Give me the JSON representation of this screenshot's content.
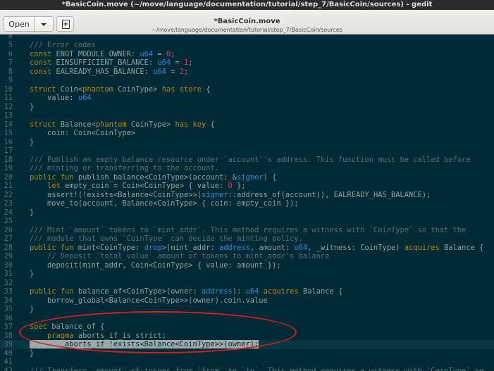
{
  "window": {
    "title": "*BasicCoin.move (~/move/language/documentation/tutorial/step_7/BasicCoin/sources) - gedit"
  },
  "header": {
    "open_label": "Open",
    "doc_title": "*BasicCoin.move",
    "doc_path": "~/move/language/documentation/tutorial/step_7/BasicCoin/sources"
  },
  "icons": {
    "menu": "chevron-down-icon",
    "new_document": "new-document-icon"
  },
  "colors": {
    "editor_bg": "#002b36",
    "annotation": "#d42020",
    "current_line": "#073642"
  },
  "editor": {
    "lines": [
      {
        "n": "4",
        "t": ""
      },
      {
        "n": "5",
        "t": "/// Error codes"
      },
      {
        "n": "6",
        "t": "const ENOT_MODULE_OWNER: u64 = 0;"
      },
      {
        "n": "7",
        "t": "const EINSUFFICIENT_BALANCE: u64 = 1;"
      },
      {
        "n": "8",
        "t": "const EALREADY_HAS_BALANCE: u64 = 2;"
      },
      {
        "n": "9",
        "t": ""
      },
      {
        "n": "10",
        "t": "struct Coin<phantom CoinType> has store {"
      },
      {
        "n": "11",
        "t": "    value: u64"
      },
      {
        "n": "12",
        "t": "}"
      },
      {
        "n": "13",
        "t": ""
      },
      {
        "n": "14",
        "t": "struct Balance<phantom CoinType> has key {"
      },
      {
        "n": "15",
        "t": "    coin: Coin<CoinType>"
      },
      {
        "n": "16",
        "t": "}"
      },
      {
        "n": "17",
        "t": ""
      },
      {
        "n": "18",
        "t": "/// Publish an empty balance resource under `account`'s address. This function must be called before"
      },
      {
        "n": "19",
        "t": "/// minting or transferring to the account."
      },
      {
        "n": "20",
        "t": "public fun publish_balance<CoinType>(account: &signer) {"
      },
      {
        "n": "21",
        "t": "    let empty_coin = Coin<CoinType> { value: 0 };"
      },
      {
        "n": "22",
        "t": "    assert!(!exists<Balance<CoinType>>(signer::address_of(account)), EALREADY_HAS_BALANCE);"
      },
      {
        "n": "23",
        "t": "    move_to(account, Balance<CoinType> { coin: empty_coin });"
      },
      {
        "n": "24",
        "t": "}"
      },
      {
        "n": "25",
        "t": ""
      },
      {
        "n": "26",
        "t": "/// Mint `amount` tokens to `mint_addr`. This method requires a witness with `CoinType` so that the"
      },
      {
        "n": "27",
        "t": "/// module that owns `CoinType` can decide the minting policy."
      },
      {
        "n": "28",
        "t": "public fun mint<CoinType: drop>(mint_addr: address, amount: u64, _witness: CoinType) acquires Balance {"
      },
      {
        "n": "29",
        "t": "    // Deposit `total_value` amount of tokens to mint_addr's balance"
      },
      {
        "n": "30",
        "t": "    deposit(mint_addr, Coin<CoinType> { value: amount });"
      },
      {
        "n": "31",
        "t": "}"
      },
      {
        "n": "32",
        "t": ""
      },
      {
        "n": "33",
        "t": "public fun balance_of<CoinType>(owner: address): u64 acquires Balance {"
      },
      {
        "n": "34",
        "t": "    borrow_global<Balance<CoinType>>(owner).coin.value"
      },
      {
        "n": "35",
        "t": "}"
      },
      {
        "n": "36",
        "t": ""
      },
      {
        "n": "37",
        "t": "spec balance_of {"
      },
      {
        "n": "38",
        "t": "    pragma aborts_if_is_strict;"
      },
      {
        "n": "39",
        "t": "        aborts_if !exists<Balance<CoinType>>(owner);"
      },
      {
        "n": "40",
        "t": "}"
      },
      {
        "n": "41",
        "t": ""
      },
      {
        "n": "42",
        "t": "/// Transfers `amount` of tokens from `from` to `to`. This method requires a witness with `CoinType` so"
      }
    ]
  }
}
